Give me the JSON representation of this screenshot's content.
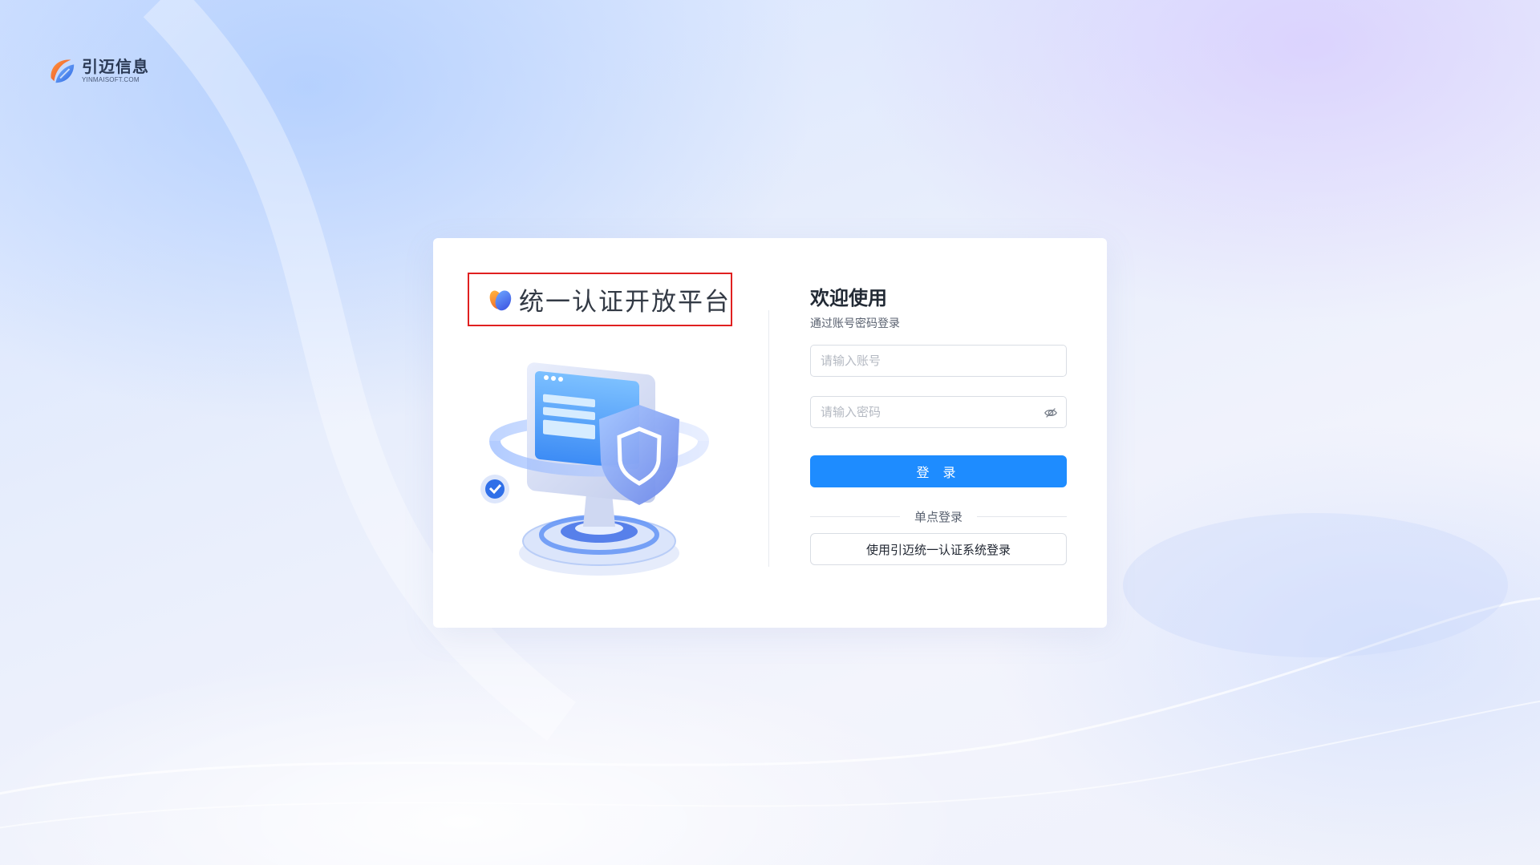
{
  "brand": {
    "name": "引迈信息",
    "domain": "YINMAISOFT.COM"
  },
  "platform": {
    "title": "统一认证开放平台",
    "highlight_color": "#e02020"
  },
  "login": {
    "welcome": "欢迎使用",
    "subtitle": "通过账号密码登录",
    "username_placeholder": "请输入账号",
    "password_placeholder": "请输入密码",
    "submit_label": "登 录",
    "submit_color": "#1e8cff",
    "sso_divider_label": "单点登录",
    "sso_button_label": "使用引迈统一认证系统登录"
  },
  "icons": {
    "password_toggle": "eye-off-icon",
    "brand_logo": "brand-logo-icon",
    "platform_logo": "platform-logo-icon"
  }
}
